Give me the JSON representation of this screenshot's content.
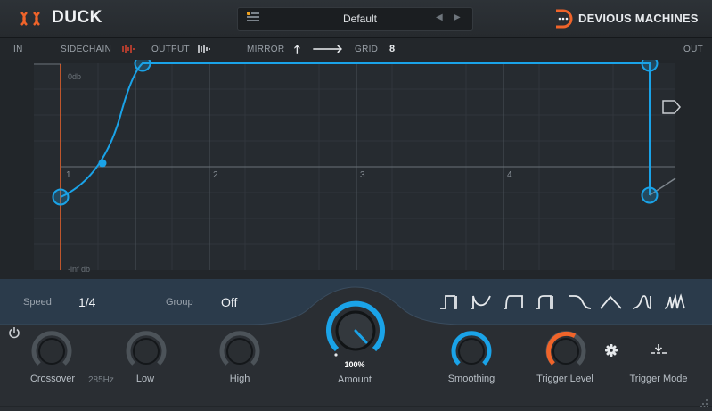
{
  "header": {
    "app_title": "DUCK",
    "preset_name": "Default",
    "prev_glyph": "◀",
    "next_glyph": "▶",
    "brand": "DEVIOUS MACHINES"
  },
  "toolbar": {
    "in_label": "IN",
    "sidechain_label": "SIDECHAIN",
    "output_label": "OUTPUT",
    "mirror_label": "MIRROR",
    "mirror_up_glyph": "🡑",
    "mirror_right_glyph": "🡒",
    "grid_label": "GRID",
    "grid_value": "8",
    "out_label": "OUT"
  },
  "editor": {
    "db_top": "0db",
    "db_bottom": "-inf db",
    "beats": [
      "1",
      "2",
      "3",
      "4"
    ]
  },
  "controls": {
    "speed_label": "Speed",
    "speed_value": "1/4",
    "group_label": "Group",
    "group_value": "Off",
    "crossover_label": "Crossover",
    "crossover_value": "285Hz",
    "low_label": "Low",
    "high_label": "High",
    "amount_label": "Amount",
    "amount_value": "100%",
    "amount_level": 1.0,
    "smoothing_label": "Smoothing",
    "trigger_level_label": "Trigger Level",
    "trigger_mode_label": "Trigger Mode"
  },
  "colors": {
    "accent_blue": "#1aa3e8",
    "accent_orange": "#f0642a",
    "band_bg": "#2b3b4b"
  },
  "icons": [
    "logo-mark-icon",
    "preset-menu-icon",
    "brand-logo-icon",
    "sidechain-icon",
    "output-icon",
    "marker-flag-icon",
    "power-icon",
    "settings-icon",
    "trigger-mode-icon",
    "resize-grip-icon"
  ]
}
